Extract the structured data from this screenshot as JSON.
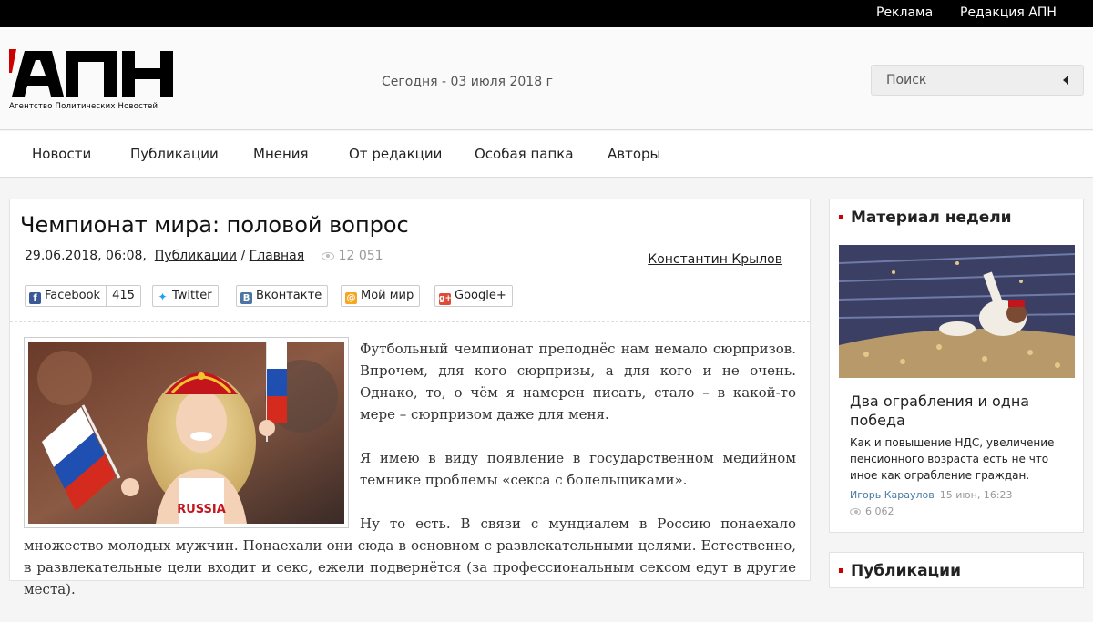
{
  "topbar": {
    "ads": "Реклама",
    "editorial": "Редакция АПН"
  },
  "logo": {
    "text": "АПН",
    "subtitle": "Агентство Политических Новостей"
  },
  "header": {
    "today": "Сегодня - 03 июля 2018 г"
  },
  "search": {
    "placeholder": "Поиск"
  },
  "nav": {
    "items": [
      "Новости",
      "Публикации",
      "Мнения",
      "От редакции",
      "Особая папка",
      "Авторы"
    ]
  },
  "article": {
    "title": "Чемпионат мира: половой вопрос",
    "date": "29.06.2018, 06:08,",
    "section": "Публикации",
    "separator": "/",
    "subsection": "Главная",
    "views": "12 051",
    "author": "Константин Крылов",
    "share": {
      "facebook": "Facebook",
      "facebook_count": "415",
      "twitter": "Twitter",
      "vkontakte": "Вконтакте",
      "moimir": "Мой мир",
      "googleplus": "Google+"
    },
    "image_caption_text": "RUSSIA",
    "paragraphs": [
      "Футбольный чемпионат преподнёс нам немало сюрпризов. Впрочем, для кого сюрпризы, а для кого и не очень. Однако, то, о чём я намерен писать, стало – в какой-то мере – сюрпризом даже для меня.",
      "Я имею в виду появление в государственном медийном темнике проблемы «секса с болельщиками».",
      "Ну то есть. В связи с мундиалем в Россию понаехало множество молодых мужчин. Понаехали они сюда в основном с развлекательными целями. Естественно, в развлекательные цели входит и секс, ежели подвернётся (за профессиональным сексом едут в другие места)."
    ]
  },
  "sidebar": {
    "week": {
      "title": "Материал недели",
      "headline": "Два ограбления и одна победа",
      "lead": "Как и повышение НДС, увеличение пенсионного возраста есть не что иное как ограбление граждан.",
      "author": "Игорь Караулов",
      "date": "15 июн, 16:23",
      "views": "6 062"
    },
    "publications": {
      "title": "Публикации"
    }
  },
  "colors": {
    "accent": "#cc0000",
    "topbar": "#000000",
    "link": "#4a7aa5"
  }
}
